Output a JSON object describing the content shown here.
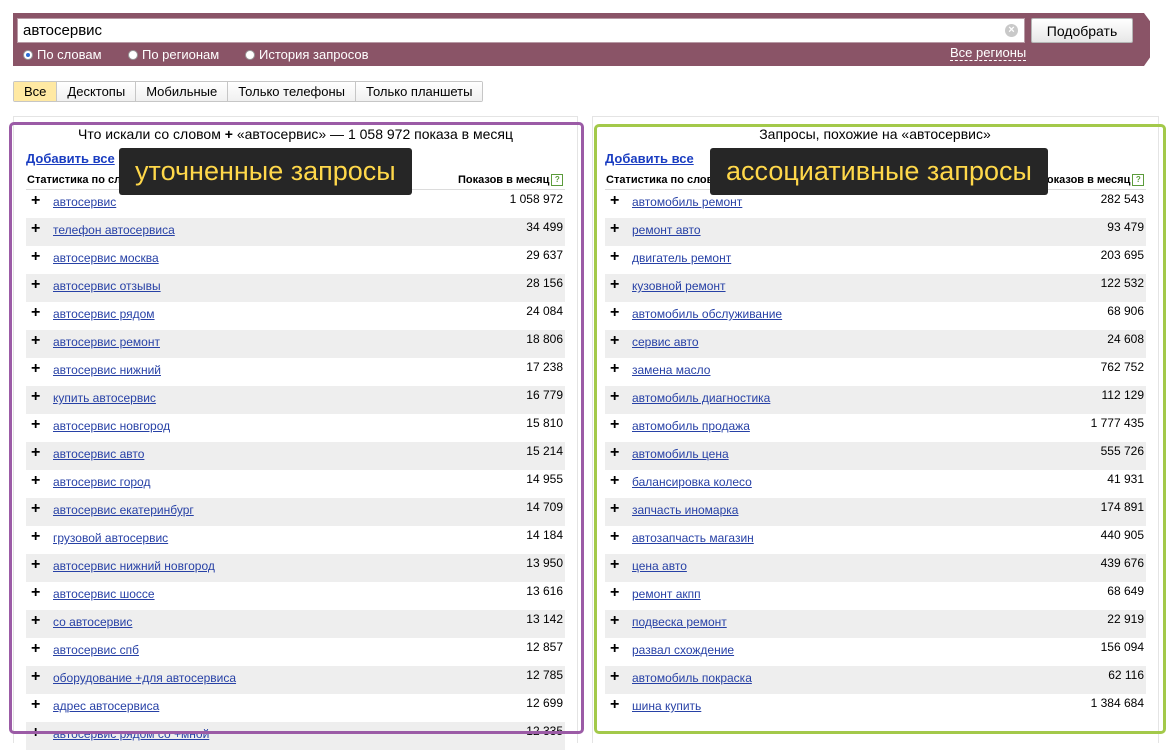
{
  "search": {
    "query": "автосервис",
    "submit_label": "Подобрать",
    "modes": [
      {
        "label": "По словам",
        "selected": true
      },
      {
        "label": "По регионам",
        "selected": false
      },
      {
        "label": "История запросов",
        "selected": false
      }
    ],
    "regions_link": "Все регионы"
  },
  "device_tabs": [
    {
      "label": "Все",
      "active": true
    },
    {
      "label": "Десктопы",
      "active": false
    },
    {
      "label": "Мобильные",
      "active": false
    },
    {
      "label": "Только телефоны",
      "active": false
    },
    {
      "label": "Только планшеты",
      "active": false
    }
  ],
  "left_panel": {
    "title_prefix": "Что искали со словом",
    "title_plus": "+",
    "title_suffix": "«автосервис» — 1 058 972 показа в месяц",
    "add_all": "Добавить все",
    "col_keyword": "Статистика по словам",
    "col_count": "Показов в месяц",
    "help": "?",
    "label": "уточненные запросы",
    "frame_color": "#9b5ba6",
    "rows": [
      {
        "keyword": "автосервис",
        "count": "1 058 972"
      },
      {
        "keyword": "телефон автосервиса",
        "count": "34 499"
      },
      {
        "keyword": "автосервис москва",
        "count": "29 637"
      },
      {
        "keyword": "автосервис отзывы",
        "count": "28 156"
      },
      {
        "keyword": "автосервис рядом",
        "count": "24 084"
      },
      {
        "keyword": "автосервис ремонт",
        "count": "18 806"
      },
      {
        "keyword": "автосервис нижний",
        "count": "17 238"
      },
      {
        "keyword": "купить автосервис",
        "count": "16 779"
      },
      {
        "keyword": "автосервис новгород",
        "count": "15 810"
      },
      {
        "keyword": "автосервис авто",
        "count": "15 214"
      },
      {
        "keyword": "автосервис город",
        "count": "14 955"
      },
      {
        "keyword": "автосервис екатеринбург",
        "count": "14 709"
      },
      {
        "keyword": "грузовой автосервис",
        "count": "14 184"
      },
      {
        "keyword": "автосервис нижний новгород",
        "count": "13 950"
      },
      {
        "keyword": "автосервис шоссе",
        "count": "13 616"
      },
      {
        "keyword": "со автосервис",
        "count": "13 142"
      },
      {
        "keyword": "автосервис спб",
        "count": "12 857"
      },
      {
        "keyword": "оборудование +для автосервиса",
        "count": "12 785"
      },
      {
        "keyword": "адрес автосервиса",
        "count": "12 699"
      },
      {
        "keyword": "автосервис рядом со +мной",
        "count": "12 335"
      }
    ]
  },
  "right_panel": {
    "title": "Запросы, похожие на «автосервис»",
    "add_all": "Добавить все",
    "col_keyword": "Статистика по словам",
    "col_count": "Показов в месяц",
    "help": "?",
    "label": "ассоциативные запросы",
    "frame_color": "#a3c94a",
    "rows": [
      {
        "keyword": "автомобиль ремонт",
        "count": "282 543"
      },
      {
        "keyword": "ремонт авто",
        "count": "93 479"
      },
      {
        "keyword": "двигатель ремонт",
        "count": "203 695"
      },
      {
        "keyword": "кузовной ремонт",
        "count": "122 532"
      },
      {
        "keyword": "автомобиль обслуживание",
        "count": "68 906"
      },
      {
        "keyword": "сервис авто",
        "count": "24 608"
      },
      {
        "keyword": "замена масло",
        "count": "762 752"
      },
      {
        "keyword": "автомобиль диагностика",
        "count": "112 129"
      },
      {
        "keyword": "автомобиль продажа",
        "count": "1 777 435"
      },
      {
        "keyword": "автомобиль цена",
        "count": "555 726"
      },
      {
        "keyword": "балансировка колесо",
        "count": "41 931"
      },
      {
        "keyword": "запчасть иномарка",
        "count": "174 891"
      },
      {
        "keyword": "автозапчасть магазин",
        "count": "440 905"
      },
      {
        "keyword": "цена авто",
        "count": "439 676"
      },
      {
        "keyword": "ремонт акпп",
        "count": "68 649"
      },
      {
        "keyword": "подвеска ремонт",
        "count": "22 919"
      },
      {
        "keyword": "развал схождение",
        "count": "156 094"
      },
      {
        "keyword": "автомобиль покраска",
        "count": "62 116"
      },
      {
        "keyword": "шина купить",
        "count": "1 384 684"
      }
    ]
  }
}
